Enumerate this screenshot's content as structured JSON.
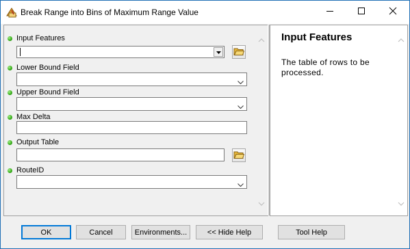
{
  "window": {
    "title": "Break Range into Bins of Maximum Range Value"
  },
  "parameters": [
    {
      "label": "Input Features",
      "value": ""
    },
    {
      "label": "Lower Bound Field",
      "value": ""
    },
    {
      "label": "Upper Bound Field",
      "value": ""
    },
    {
      "label": "Max Delta",
      "value": ""
    },
    {
      "label": "Output Table",
      "value": ""
    },
    {
      "label": "RouteID",
      "value": ""
    }
  ],
  "help": {
    "title": "Input Features",
    "text": "The table of rows to be processed."
  },
  "buttons": {
    "ok": "OK",
    "cancel": "Cancel",
    "environments": "Environments...",
    "hide_help": "<< Hide Help",
    "tool_help": "Tool Help"
  },
  "colors": {
    "required_dot": "#3cb01f",
    "window_border": "#1f6fb5",
    "default_button_border": "#0078d7"
  },
  "icons": [
    "app-icon",
    "minimize-icon",
    "maximize-icon",
    "close-icon",
    "folder-open-icon",
    "chevron-down-icon",
    "scroll-up-icon",
    "scroll-down-icon"
  ]
}
